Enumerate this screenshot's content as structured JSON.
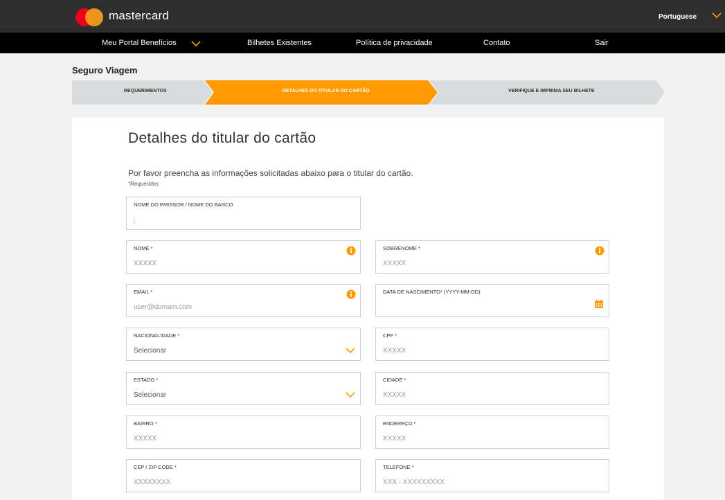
{
  "header": {
    "brand": "mastercard",
    "language": "Portuguese"
  },
  "nav": {
    "items": [
      {
        "label": "Meu Portal Benefícios"
      },
      {
        "label": "Bilhetes Existentes"
      },
      {
        "label": "Política de privacidade"
      },
      {
        "label": "Contato"
      },
      {
        "label": "Sair"
      }
    ]
  },
  "page_title": "Seguro Viagem",
  "steps": [
    {
      "label": "REQUERIMENTOS",
      "state": "done"
    },
    {
      "label": "DETALHES DO TITULAR DO CARTÃO",
      "state": "active"
    },
    {
      "label": "VERIFIQUE E IMPRIMA SEU BILHETE",
      "state": "pending"
    }
  ],
  "form": {
    "title": "Detalhes do titular do cartão",
    "intro": "Por favor preencha as informações solicitadas abaixo para o titular do cartão.",
    "required_note": "*Requeridos",
    "fields": {
      "issuer": {
        "label": "NOME DO EMISSOR / NOME DO BANCO",
        "value": ""
      },
      "first_name": {
        "label": "NOME *",
        "placeholder": "XXXXX"
      },
      "last_name": {
        "label": "SOBRENOME *",
        "placeholder": "XXXXX"
      },
      "email": {
        "label": "EMAIL *",
        "placeholder": "user@domain.com"
      },
      "birth_date": {
        "label": "DATA DE NASCIMENTO* (YYYY-MM-DD)",
        "value": ""
      },
      "nationality": {
        "label": "NACIONALIDADE *",
        "value": "Selecionar"
      },
      "cpf": {
        "label": "CPF *",
        "placeholder": "XXXXX"
      },
      "state": {
        "label": "ESTADO *",
        "value": "Selecionar"
      },
      "city": {
        "label": "CIDADE *",
        "placeholder": "XXXXX"
      },
      "neighborhood": {
        "label": "BAIRRO *",
        "placeholder": "XXXXX"
      },
      "address": {
        "label": "ENDEREÇO *",
        "placeholder": "XXXXX"
      },
      "zip": {
        "label": "CEP / ZIP CODE *",
        "placeholder": "XXXXXXXX"
      },
      "phone": {
        "label": "TELEFONE *",
        "placeholder": "XXX - XXXXXXXXX"
      }
    }
  },
  "colors": {
    "accent": "#ff9a00",
    "topbar": "#2e2e2e",
    "navbar": "#000000",
    "step_inactive": "#d9dcdc"
  },
  "icons": {
    "info": "info-circle-icon",
    "chevron": "chevron-down-icon",
    "calendar": "calendar-icon"
  }
}
